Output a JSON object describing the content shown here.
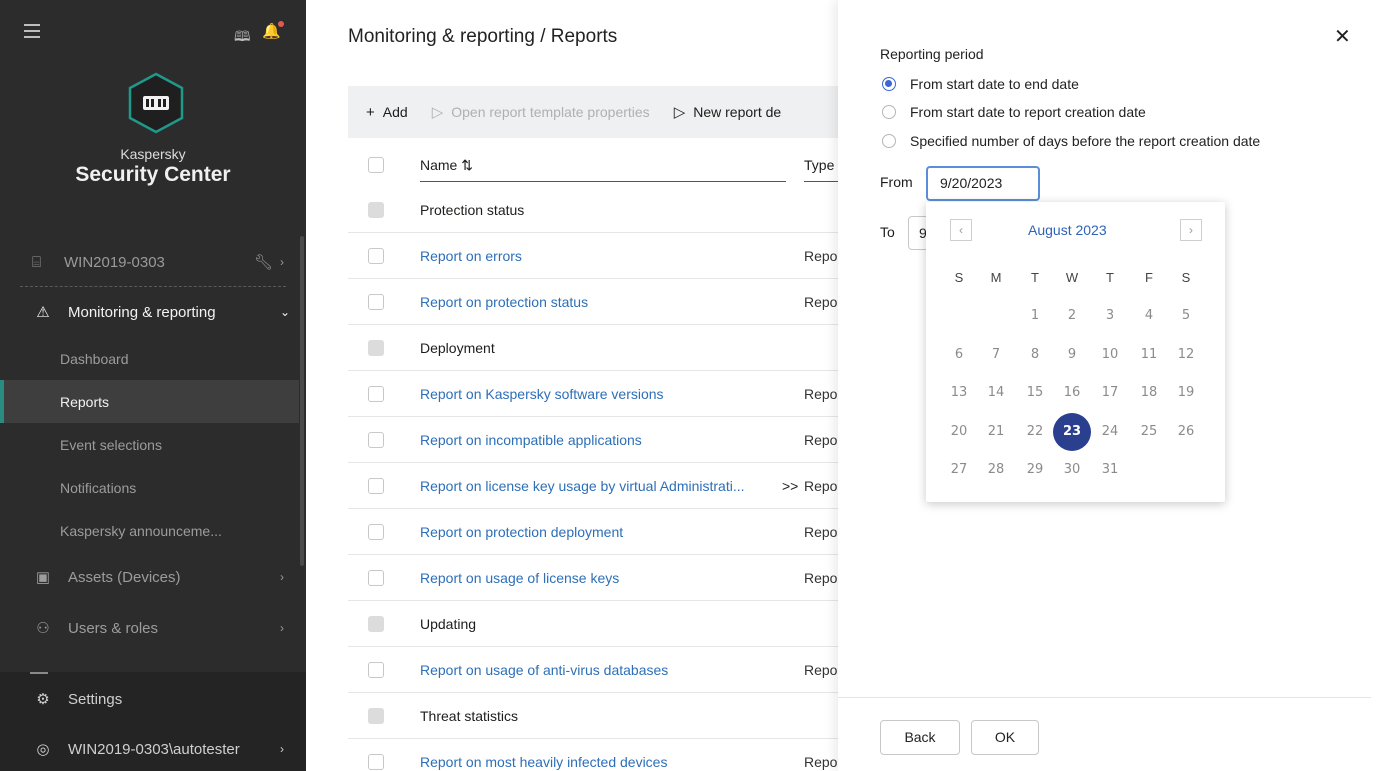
{
  "sidebar": {
    "brand_top": "Kaspersky",
    "brand_main": "Security Center",
    "device": "WIN2019-0303",
    "monitoring": "Monitoring & reporting",
    "sub_items": [
      "Dashboard",
      "Reports",
      "Event selections",
      "Notifications",
      "Kaspersky announceme..."
    ],
    "assets": "Assets (Devices)",
    "users": "Users & roles",
    "settings": "Settings",
    "user": "WIN2019-0303\\autotester"
  },
  "main": {
    "breadcrumb": "Monitoring & reporting  /  Reports",
    "toolbar": {
      "add": "Add",
      "open_props": "Open report template properties",
      "new_report": "New report de"
    },
    "columns": {
      "name": "Name ⇅",
      "type": "Type"
    },
    "rows": [
      {
        "name": "Protection status",
        "type": "",
        "group": true
      },
      {
        "name": "Report on errors",
        "type": "Repo",
        "group": false
      },
      {
        "name": "Report on protection status",
        "type": "Repo",
        "group": false
      },
      {
        "name": "Deployment",
        "type": "",
        "group": true
      },
      {
        "name": "Report on Kaspersky software versions",
        "type": "Repo",
        "group": false
      },
      {
        "name": "Report on incompatible applications",
        "type": "Repo",
        "group": false
      },
      {
        "name": "Report on license key usage by virtual Administrati...",
        "type": "Repo",
        "group": false,
        "more": ">>"
      },
      {
        "name": "Report on protection deployment",
        "type": "Repo",
        "group": false
      },
      {
        "name": "Report on usage of license keys",
        "type": "Repo",
        "group": false
      },
      {
        "name": "Updating",
        "type": "",
        "group": true
      },
      {
        "name": "Report on usage of anti-virus databases",
        "type": "Repo",
        "group": false
      },
      {
        "name": "Threat statistics",
        "type": "",
        "group": true
      },
      {
        "name": "Report on most heavily infected devices",
        "type": "Repo",
        "group": false
      }
    ]
  },
  "panel": {
    "title": "Reporting period",
    "options": [
      "From start date to end date",
      "From start date to report creation date",
      "Specified number of days before the report creation date"
    ],
    "selected_option": 0,
    "from_label": "From",
    "from_value": "9/20/2023",
    "to_label": "To",
    "to_value": "9",
    "calendar": {
      "month_year": "August  2023",
      "dow": [
        "S",
        "M",
        "T",
        "W",
        "T",
        "F",
        "S"
      ],
      "first_weekday": 2,
      "days_in_month": 31,
      "selected_day": 23
    },
    "back": "Back",
    "ok": "OK"
  }
}
